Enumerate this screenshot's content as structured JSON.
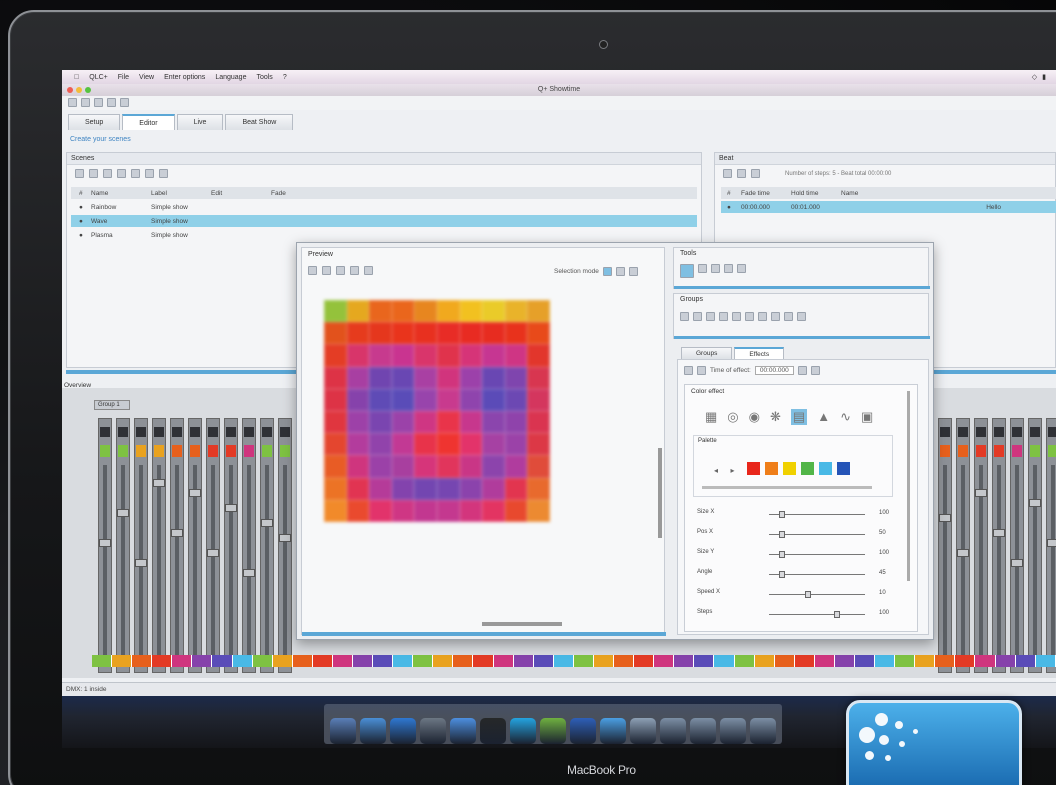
{
  "menu": {
    "items": [
      "QLC+",
      "File",
      "View",
      "Enter options",
      "Language",
      "Tools",
      "?"
    ]
  },
  "window_title": "Q+ Showtime",
  "tabs": [
    {
      "label": "Setup"
    },
    {
      "label": "Editor"
    },
    {
      "label": "Live"
    },
    {
      "label": "Beat Show"
    }
  ],
  "breadcrumb": "Create your scenes",
  "scenes_panel": {
    "title": "Scenes",
    "columns": [
      "#",
      "Name",
      "Label",
      "Edit",
      "Fade"
    ],
    "rows": [
      {
        "id": "",
        "name": "Rainbow",
        "label": "Simple show"
      },
      {
        "id": "",
        "name": "Wave",
        "label": "Simple show"
      },
      {
        "id": "",
        "name": "Plasma",
        "label": "Simple show"
      }
    ]
  },
  "beat_panel": {
    "title": "Beat",
    "info": "Number of steps: 5 - Beat total 00:00:00",
    "columns": [
      "#",
      "Fade time",
      "Hold time",
      "Name"
    ],
    "row": {
      "fade": "00:00.000",
      "hold": "00:01.000",
      "name": "Hello"
    }
  },
  "overview_label": "Overview",
  "channel_group": "Group 1",
  "matrix_dialog": {
    "preview_title": "Preview",
    "selection_mode": "Selection mode",
    "tools_title": "Tools",
    "groups_title": "Groups",
    "inner_tabs": [
      "Groups",
      "Effects"
    ],
    "time_label": "Time of effect:",
    "time_value": "00:00.000",
    "effect_section": "Color effect",
    "palette_title": "Palette",
    "sliders": [
      {
        "label": "Size X",
        "value": "100"
      },
      {
        "label": "Pos X",
        "value": "50"
      },
      {
        "label": "Size Y",
        "value": "100"
      },
      {
        "label": "Angle",
        "value": "45"
      },
      {
        "label": "Speed X",
        "value": "10"
      },
      {
        "label": "Steps",
        "value": "100"
      }
    ]
  },
  "status_text": "DMX: 1 inside",
  "laptop_caption": "MacBook Pro",
  "colors": {
    "accent": "#5ba7d6",
    "selection": "#8fd0e8",
    "dock_app": "#2d86cc"
  },
  "palette_colors": [
    "#e8261b",
    "#ef7e19",
    "#f0d100",
    "#52b548",
    "#49b9e6",
    "#2554b7"
  ],
  "heatmap": [
    [
      "#94c23b",
      "#e5a81f",
      "#e9661d",
      "#ea661c",
      "#e7861f",
      "#f1a91e",
      "#f2c120",
      "#eacb29",
      "#e9b32a",
      "#e6a029"
    ],
    [
      "#e2521c",
      "#e63b1d",
      "#e5371d",
      "#e9341c",
      "#e8301f",
      "#e82c26",
      "#e82b22",
      "#e72c20",
      "#e8321c",
      "#e84a1a"
    ],
    [
      "#e43d25",
      "#d8356a",
      "#c73a8e",
      "#c93490",
      "#d9356b",
      "#e0334c",
      "#d63478",
      "#c63692",
      "#cf3584",
      "#e2362c"
    ],
    [
      "#dd3346",
      "#a83fa2",
      "#7045b0",
      "#6947b3",
      "#a940a3",
      "#d1347d",
      "#9c41aa",
      "#6947b3",
      "#7f45ae",
      "#d83650"
    ],
    [
      "#dd3346",
      "#8642ab",
      "#5f4bb6",
      "#5a4cb8",
      "#9844ac",
      "#c83a8e",
      "#8f44ad",
      "#5b4bb8",
      "#6c48b3",
      "#d4365e"
    ],
    [
      "#e0363f",
      "#9d41a8",
      "#7a45b0",
      "#9b42a9",
      "#cf3683",
      "#e9344a",
      "#c7378d",
      "#8b45ad",
      "#8f43ab",
      "#da3450"
    ],
    [
      "#e4462f",
      "#b33c9d",
      "#9143ab",
      "#c23994",
      "#e8334a",
      "#ef3430",
      "#e3336a",
      "#a641a3",
      "#9b42a8",
      "#dc3846"
    ],
    [
      "#e85c25",
      "#cf357e",
      "#9b41a8",
      "#a83f9f",
      "#d6357a",
      "#e1355c",
      "#c93686",
      "#8c44ac",
      "#b03c9e",
      "#e04c3a"
    ],
    [
      "#ec7325",
      "#e13452",
      "#b53b99",
      "#8343ad",
      "#7346b1",
      "#7646b1",
      "#8b43ac",
      "#b03c9c",
      "#e2354f",
      "#e86a2d"
    ],
    [
      "#f18a2a",
      "#ea4a2e",
      "#e2336b",
      "#cf3684",
      "#c23790",
      "#c4388f",
      "#d3357d",
      "#e33462",
      "#e8492e",
      "#ec8a31"
    ]
  ],
  "fader_colors": [
    "#7ec242",
    "#7ec242",
    "#e9a21f",
    "#e9a21f",
    "#e7601c",
    "#e7601c",
    "#e33a25",
    "#e33a25",
    "#cf357e"
  ],
  "dock_colors": [
    "#5a7fb8",
    "#4a8fd6",
    "#2f78d2",
    "#6c7784",
    "#4d8fdf",
    "#262829",
    "#24a4e0",
    "#6fb140",
    "#2e5fb8",
    "#4b9fe3",
    "#8da0b5",
    "#7c8fa5",
    "#7c8fa5",
    "#7c8fa5",
    "#7c8fa5"
  ]
}
